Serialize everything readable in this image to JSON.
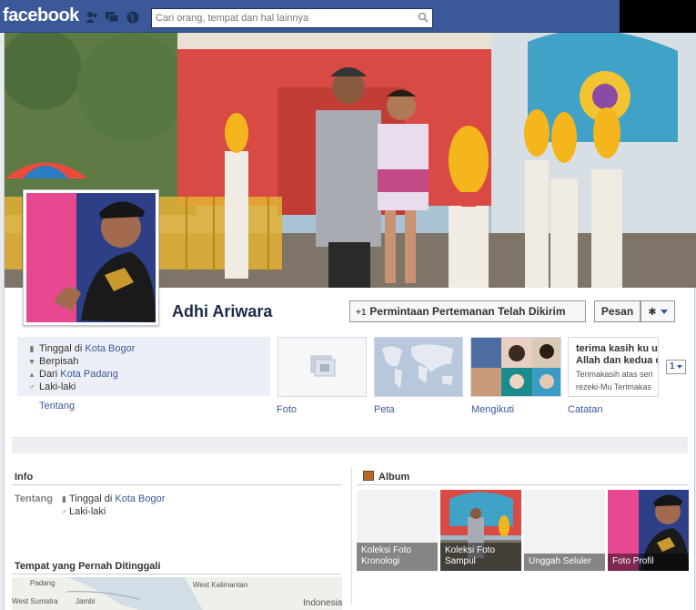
{
  "header": {
    "logo": "facebook",
    "search_placeholder": "Cari orang, tempat dan hal lainnya",
    "icons": [
      "friend-requests-icon",
      "messages-icon",
      "notifications-globe-icon",
      "search-icon"
    ]
  },
  "profile": {
    "name": "Adhi Ariwara",
    "friend_button": "Permintaan Pertemanan Telah Dikirim",
    "message_button": "Pesan"
  },
  "about": {
    "lived_prefix": "Tinggal di",
    "lived_place": "Kota Bogor",
    "relationship": "Berpisah",
    "from_prefix": "Dari",
    "from_place": "Kota Padang",
    "gender": "Laki-laki",
    "tab": "Tentang"
  },
  "tabs": {
    "photos": "Foto",
    "map": "Peta",
    "following": "Mengikuti",
    "notes": "Catatan",
    "more_count": "1"
  },
  "notes_preview": {
    "line1": "terima kasih ku u",
    "line2": "Allah dan kedua o",
    "line3": "Terimakasih atas seri",
    "line4": "rezeki-Mu Terimakas"
  },
  "info": {
    "title": "Info",
    "key": "Tentang",
    "lived_prefix": "Tinggal di",
    "lived_place": "Kota Bogor",
    "gender": "Laki-laki",
    "places_title": "Tempat yang Pernah Ditinggali",
    "map_labels": [
      "Padang",
      "West Kalimantan",
      "West Sumatra",
      "Jambi",
      "Indonesia"
    ]
  },
  "album": {
    "title": "Album",
    "items": [
      "Koleksi Foto Kronologi",
      "Koleksi Foto Sampul",
      "Unggah Seluler",
      "Foto Profil"
    ]
  },
  "colors": {
    "brand": "#3b5998",
    "link": "#3b5998",
    "topbar_border": "#29487d"
  }
}
